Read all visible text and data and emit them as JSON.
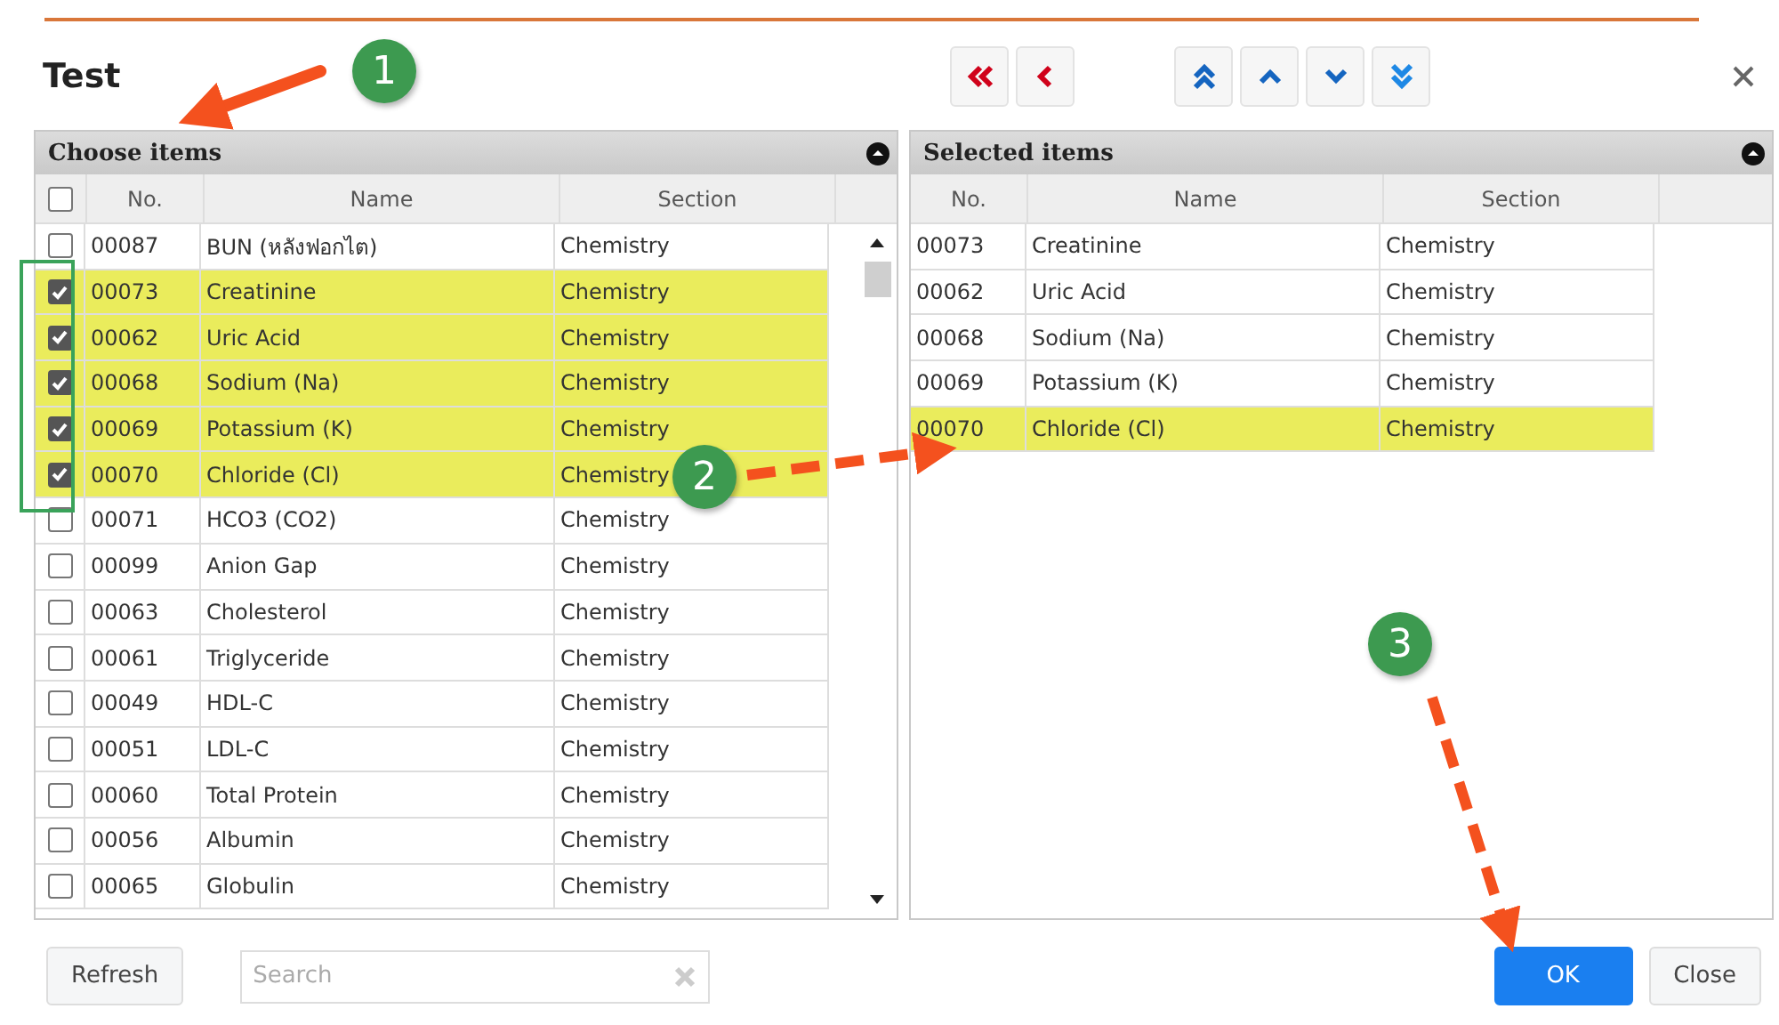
{
  "window": {
    "title": "Test"
  },
  "toolbar": [
    {
      "kind": "first"
    },
    {
      "kind": "back"
    },
    {
      "kind": "top"
    },
    {
      "kind": "up"
    },
    {
      "kind": "down"
    },
    {
      "kind": "bottom"
    }
  ],
  "choose_panel": {
    "title": "Choose items",
    "all_checked": false,
    "columns": [
      "No.",
      "Name",
      "Section"
    ],
    "rows": [
      {
        "checked": false,
        "no": "00087",
        "name": "BUN (หลังฟอกไต)",
        "section": "Chemistry"
      },
      {
        "checked": true,
        "no": "00073",
        "name": "Creatinine",
        "section": "Chemistry"
      },
      {
        "checked": true,
        "no": "00062",
        "name": "Uric Acid",
        "section": "Chemistry"
      },
      {
        "checked": true,
        "no": "00068",
        "name": "Sodium (Na)",
        "section": "Chemistry"
      },
      {
        "checked": true,
        "no": "00069",
        "name": "Potassium (K)",
        "section": "Chemistry"
      },
      {
        "checked": true,
        "no": "00070",
        "name": "Chloride (Cl)",
        "section": "Chemistry"
      },
      {
        "checked": false,
        "no": "00071",
        "name": "HCO3 (CO2)",
        "section": "Chemistry"
      },
      {
        "checked": false,
        "no": "00099",
        "name": "Anion Gap",
        "section": "Chemistry"
      },
      {
        "checked": false,
        "no": "00063",
        "name": "Cholesterol",
        "section": "Chemistry"
      },
      {
        "checked": false,
        "no": "00061",
        "name": "Triglyceride",
        "section": "Chemistry"
      },
      {
        "checked": false,
        "no": "00049",
        "name": "HDL-C",
        "section": "Chemistry"
      },
      {
        "checked": false,
        "no": "00051",
        "name": "LDL-C",
        "section": "Chemistry"
      },
      {
        "checked": false,
        "no": "00060",
        "name": "Total Protein",
        "section": "Chemistry"
      },
      {
        "checked": false,
        "no": "00056",
        "name": "Albumin",
        "section": "Chemistry"
      },
      {
        "checked": false,
        "no": "00065",
        "name": "Globulin",
        "section": "Chemistry"
      }
    ]
  },
  "selected_panel": {
    "title": "Selected items",
    "columns": [
      "No.",
      "Name",
      "Section"
    ],
    "rows": [
      {
        "selected": false,
        "no": "00073",
        "name": "Creatinine",
        "section": "Chemistry"
      },
      {
        "selected": false,
        "no": "00062",
        "name": "Uric Acid",
        "section": "Chemistry"
      },
      {
        "selected": false,
        "no": "00068",
        "name": "Sodium (Na)",
        "section": "Chemistry"
      },
      {
        "selected": false,
        "no": "00069",
        "name": "Potassium (K)",
        "section": "Chemistry"
      },
      {
        "selected": true,
        "no": "00070",
        "name": "Chloride (Cl)",
        "section": "Chemistry"
      }
    ]
  },
  "footer": {
    "refresh": "Refresh",
    "search": {
      "placeholder": "Search"
    },
    "ok": "OK",
    "close": "Close"
  },
  "annotations": [
    {
      "kind": "arrow"
    },
    {
      "kind": "frame"
    },
    {
      "kind": "dashed-arrow"
    },
    {
      "kind": "dashed-arrow"
    },
    {
      "kind": "step",
      "label": "1"
    },
    {
      "kind": "step",
      "label": "2"
    },
    {
      "kind": "step",
      "label": "3"
    }
  ]
}
